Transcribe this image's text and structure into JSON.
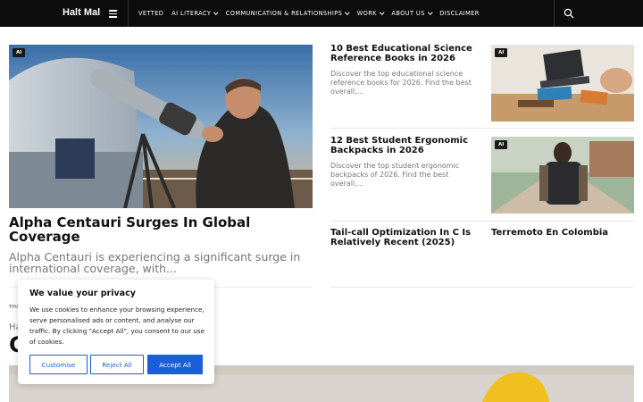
{
  "header": {
    "brand": "Halt Mal",
    "nav": [
      {
        "label": "VETTED",
        "dropdown": false
      },
      {
        "label": "AI LITERACY",
        "dropdown": true
      },
      {
        "label": "COMMUNICATION & RELATIONSHIPS",
        "dropdown": true
      },
      {
        "label": "WORK",
        "dropdown": true
      },
      {
        "label": "ABOUT US",
        "dropdown": true
      },
      {
        "label": "DISCLAIMER",
        "dropdown": false
      }
    ]
  },
  "hero": {
    "badge": "AI",
    "title": "Alpha Centauri Surges In Global Coverage",
    "excerpt": "Alpha Centauri is experiencing a significant surge in international coverage, with..."
  },
  "cards": [
    {
      "title": "10 Best Educational Science Reference Books in 2026",
      "excerpt": "Discover the top educational science reference books for 2026. Find the best overall,...",
      "badge": "AI"
    },
    {
      "title": "12 Best Student Ergonomic Backpacks in 2026",
      "excerpt": "Discover the top student ergonomic backpacks of 2026. Find the best overall,...",
      "badge": "AI"
    }
  ],
  "bottom_links": [
    {
      "title": "Tail-call Optimization In C Is Relatively Recent (2025)"
    },
    {
      "title": "Terremoto En Colombia"
    }
  ],
  "partial_section": {
    "tag": "THI",
    "subtitle": "Ha",
    "heading": "C"
  },
  "cookie": {
    "title": "We value your privacy",
    "text": "We use cookies to enhance your browsing experience, serve personalised ads or content, and analyse our traffic. By clicking \"Accept All\", you consent to our use of cookies.",
    "customise": "Customise",
    "reject": "Reject All",
    "accept": "Accept All"
  },
  "colors": {
    "header_bg": "#0c0c0c",
    "accent": "#1a5fd8",
    "muted_text": "#777777"
  }
}
